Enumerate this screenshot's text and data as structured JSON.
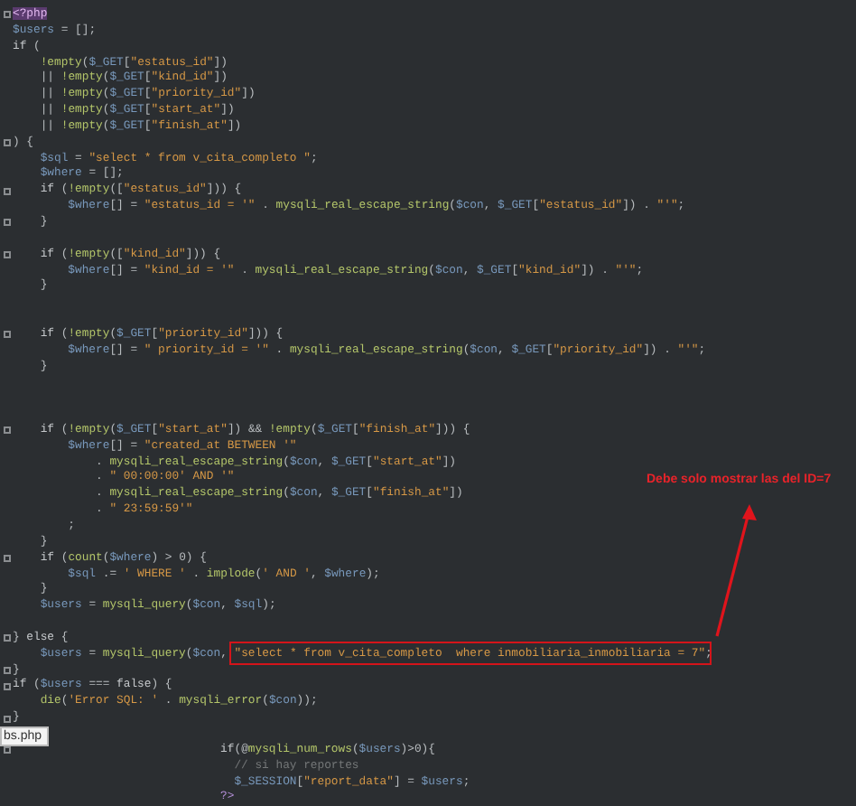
{
  "lines": [
    {
      "kind": "code",
      "fold": true,
      "tokens": [
        {
          "kind": "tag",
          "text": "<?php"
        }
      ]
    },
    {
      "kind": "code",
      "fold": false,
      "tokens": [
        {
          "kind": "var",
          "text": "$users"
        },
        {
          "kind": "op",
          "text": " = [];"
        }
      ]
    },
    {
      "kind": "code",
      "fold": false,
      "tokens": [
        {
          "kind": "kw",
          "text": "if"
        },
        {
          "kind": "op",
          "text": " ("
        }
      ]
    },
    {
      "kind": "code",
      "fold": false,
      "tokens": [
        {
          "kind": "fn",
          "text": "    !empty"
        },
        {
          "kind": "op",
          "text": "("
        },
        {
          "kind": "var",
          "text": "$_GET"
        },
        {
          "kind": "op",
          "text": "["
        },
        {
          "kind": "str",
          "text": "\"estatus_id\""
        },
        {
          "kind": "op",
          "text": "])"
        }
      ]
    },
    {
      "kind": "code",
      "fold": false,
      "tokens": [
        {
          "kind": "op",
          "text": "    || "
        },
        {
          "kind": "fn",
          "text": "!empty"
        },
        {
          "kind": "op",
          "text": "("
        },
        {
          "kind": "var",
          "text": "$_GET"
        },
        {
          "kind": "op",
          "text": "["
        },
        {
          "kind": "str",
          "text": "\"kind_id\""
        },
        {
          "kind": "op",
          "text": "])"
        }
      ]
    },
    {
      "kind": "code",
      "fold": false,
      "tokens": [
        {
          "kind": "op",
          "text": "    || "
        },
        {
          "kind": "fn",
          "text": "!empty"
        },
        {
          "kind": "op",
          "text": "("
        },
        {
          "kind": "var",
          "text": "$_GET"
        },
        {
          "kind": "op",
          "text": "["
        },
        {
          "kind": "str",
          "text": "\"priority_id\""
        },
        {
          "kind": "op",
          "text": "])"
        }
      ]
    },
    {
      "kind": "code",
      "fold": false,
      "tokens": [
        {
          "kind": "op",
          "text": "    || "
        },
        {
          "kind": "fn",
          "text": "!empty"
        },
        {
          "kind": "op",
          "text": "("
        },
        {
          "kind": "var",
          "text": "$_GET"
        },
        {
          "kind": "op",
          "text": "["
        },
        {
          "kind": "str",
          "text": "\"start_at\""
        },
        {
          "kind": "op",
          "text": "])"
        }
      ]
    },
    {
      "kind": "code",
      "fold": false,
      "tokens": [
        {
          "kind": "op",
          "text": "    || "
        },
        {
          "kind": "fn",
          "text": "!empty"
        },
        {
          "kind": "op",
          "text": "("
        },
        {
          "kind": "var",
          "text": "$_GET"
        },
        {
          "kind": "op",
          "text": "["
        },
        {
          "kind": "str",
          "text": "\"finish_at\""
        },
        {
          "kind": "op",
          "text": "])"
        }
      ]
    },
    {
      "kind": "code",
      "fold": true,
      "tokens": [
        {
          "kind": "op",
          "text": ") {"
        }
      ]
    },
    {
      "kind": "code",
      "fold": false,
      "tokens": [
        {
          "kind": "var",
          "text": "    $sql"
        },
        {
          "kind": "op",
          "text": " = "
        },
        {
          "kind": "str",
          "text": "\"select * from v_cita_completo \""
        },
        {
          "kind": "op",
          "text": ";"
        }
      ]
    },
    {
      "kind": "code",
      "fold": false,
      "tokens": [
        {
          "kind": "var",
          "text": "    $where"
        },
        {
          "kind": "op",
          "text": " = [];"
        }
      ]
    },
    {
      "kind": "code",
      "fold": true,
      "tokens": [
        {
          "kind": "kw",
          "text": "    if"
        },
        {
          "kind": "op",
          "text": " ("
        },
        {
          "kind": "fn",
          "text": "!empty"
        },
        {
          "kind": "op",
          "text": "(["
        },
        {
          "kind": "str",
          "text": "\"estatus_id\""
        },
        {
          "kind": "op",
          "text": "])) {"
        }
      ]
    },
    {
      "kind": "code",
      "fold": false,
      "tokens": [
        {
          "kind": "var",
          "text": "        $where"
        },
        {
          "kind": "op",
          "text": "[] = "
        },
        {
          "kind": "str",
          "text": "\"estatus_id = '\""
        },
        {
          "kind": "op",
          "text": " . "
        },
        {
          "kind": "fn",
          "text": "mysqli_real_escape_string"
        },
        {
          "kind": "op",
          "text": "("
        },
        {
          "kind": "var",
          "text": "$con"
        },
        {
          "kind": "op",
          "text": ", "
        },
        {
          "kind": "var",
          "text": "$_GET"
        },
        {
          "kind": "op",
          "text": "["
        },
        {
          "kind": "str",
          "text": "\"estatus_id\""
        },
        {
          "kind": "op",
          "text": "]) . "
        },
        {
          "kind": "str",
          "text": "\"'\""
        },
        {
          "kind": "op",
          "text": ";"
        }
      ]
    },
    {
      "kind": "code",
      "fold": true,
      "tokens": [
        {
          "kind": "op",
          "text": "    }"
        }
      ]
    },
    {
      "kind": "blank"
    },
    {
      "kind": "code",
      "fold": true,
      "tokens": [
        {
          "kind": "kw",
          "text": "    if"
        },
        {
          "kind": "op",
          "text": " ("
        },
        {
          "kind": "fn",
          "text": "!empty"
        },
        {
          "kind": "op",
          "text": "(["
        },
        {
          "kind": "str",
          "text": "\"kind_id\""
        },
        {
          "kind": "op",
          "text": "])) {"
        }
      ]
    },
    {
      "kind": "code",
      "fold": false,
      "tokens": [
        {
          "kind": "var",
          "text": "        $where"
        },
        {
          "kind": "op",
          "text": "[] = "
        },
        {
          "kind": "str",
          "text": "\"kind_id = '\""
        },
        {
          "kind": "op",
          "text": " . "
        },
        {
          "kind": "fn",
          "text": "mysqli_real_escape_string"
        },
        {
          "kind": "op",
          "text": "("
        },
        {
          "kind": "var",
          "text": "$con"
        },
        {
          "kind": "op",
          "text": ", "
        },
        {
          "kind": "var",
          "text": "$_GET"
        },
        {
          "kind": "op",
          "text": "["
        },
        {
          "kind": "str",
          "text": "\"kind_id\""
        },
        {
          "kind": "op",
          "text": "]) . "
        },
        {
          "kind": "str",
          "text": "\"'\""
        },
        {
          "kind": "op",
          "text": ";"
        }
      ]
    },
    {
      "kind": "code",
      "fold": false,
      "tokens": [
        {
          "kind": "op",
          "text": "    }"
        }
      ]
    },
    {
      "kind": "blank"
    },
    {
      "kind": "blank"
    },
    {
      "kind": "code",
      "fold": true,
      "tokens": [
        {
          "kind": "kw",
          "text": "    if"
        },
        {
          "kind": "op",
          "text": " ("
        },
        {
          "kind": "fn",
          "text": "!empty"
        },
        {
          "kind": "op",
          "text": "("
        },
        {
          "kind": "var",
          "text": "$_GET"
        },
        {
          "kind": "op",
          "text": "["
        },
        {
          "kind": "str",
          "text": "\"priority_id\""
        },
        {
          "kind": "op",
          "text": "])) {"
        }
      ]
    },
    {
      "kind": "code",
      "fold": false,
      "tokens": [
        {
          "kind": "var",
          "text": "        $where"
        },
        {
          "kind": "op",
          "text": "[] = "
        },
        {
          "kind": "str",
          "text": "\" priority_id = '\""
        },
        {
          "kind": "op",
          "text": " . "
        },
        {
          "kind": "fn",
          "text": "mysqli_real_escape_string"
        },
        {
          "kind": "op",
          "text": "("
        },
        {
          "kind": "var",
          "text": "$con"
        },
        {
          "kind": "op",
          "text": ", "
        },
        {
          "kind": "var",
          "text": "$_GET"
        },
        {
          "kind": "op",
          "text": "["
        },
        {
          "kind": "str",
          "text": "\"priority_id\""
        },
        {
          "kind": "op",
          "text": "]) . "
        },
        {
          "kind": "str",
          "text": "\"'\""
        },
        {
          "kind": "op",
          "text": ";"
        }
      ]
    },
    {
      "kind": "code",
      "fold": false,
      "tokens": [
        {
          "kind": "op",
          "text": "    }"
        }
      ]
    },
    {
      "kind": "blank"
    },
    {
      "kind": "blank"
    },
    {
      "kind": "blank"
    },
    {
      "kind": "code",
      "fold": true,
      "tokens": [
        {
          "kind": "kw",
          "text": "    if"
        },
        {
          "kind": "op",
          "text": " ("
        },
        {
          "kind": "fn",
          "text": "!empty"
        },
        {
          "kind": "op",
          "text": "("
        },
        {
          "kind": "var",
          "text": "$_GET"
        },
        {
          "kind": "op",
          "text": "["
        },
        {
          "kind": "str",
          "text": "\"start_at\""
        },
        {
          "kind": "op",
          "text": "]) && "
        },
        {
          "kind": "fn",
          "text": "!empty"
        },
        {
          "kind": "op",
          "text": "("
        },
        {
          "kind": "var",
          "text": "$_GET"
        },
        {
          "kind": "op",
          "text": "["
        },
        {
          "kind": "str",
          "text": "\"finish_at\""
        },
        {
          "kind": "op",
          "text": "])) {"
        }
      ]
    },
    {
      "kind": "code",
      "fold": false,
      "tokens": [
        {
          "kind": "var",
          "text": "        $where"
        },
        {
          "kind": "op",
          "text": "[] = "
        },
        {
          "kind": "str",
          "text": "\"created_at BETWEEN '\""
        }
      ]
    },
    {
      "kind": "code",
      "fold": false,
      "tokens": [
        {
          "kind": "op",
          "text": "            . "
        },
        {
          "kind": "fn",
          "text": "mysqli_real_escape_string"
        },
        {
          "kind": "op",
          "text": "("
        },
        {
          "kind": "var",
          "text": "$con"
        },
        {
          "kind": "op",
          "text": ", "
        },
        {
          "kind": "var",
          "text": "$_GET"
        },
        {
          "kind": "op",
          "text": "["
        },
        {
          "kind": "str",
          "text": "\"start_at\""
        },
        {
          "kind": "op",
          "text": "])"
        }
      ]
    },
    {
      "kind": "code",
      "fold": false,
      "tokens": [
        {
          "kind": "op",
          "text": "            . "
        },
        {
          "kind": "str",
          "text": "\" 00:00:00' AND '\""
        }
      ]
    },
    {
      "kind": "code",
      "fold": false,
      "tokens": [
        {
          "kind": "op",
          "text": "            . "
        },
        {
          "kind": "fn",
          "text": "mysqli_real_escape_string"
        },
        {
          "kind": "op",
          "text": "("
        },
        {
          "kind": "var",
          "text": "$con"
        },
        {
          "kind": "op",
          "text": ", "
        },
        {
          "kind": "var",
          "text": "$_GET"
        },
        {
          "kind": "op",
          "text": "["
        },
        {
          "kind": "str",
          "text": "\"finish_at\""
        },
        {
          "kind": "op",
          "text": "])"
        }
      ]
    },
    {
      "kind": "code",
      "fold": false,
      "tokens": [
        {
          "kind": "op",
          "text": "            . "
        },
        {
          "kind": "str",
          "text": "\" 23:59:59'\""
        }
      ]
    },
    {
      "kind": "code",
      "fold": false,
      "tokens": [
        {
          "kind": "op",
          "text": "        ;"
        }
      ]
    },
    {
      "kind": "code",
      "fold": false,
      "tokens": [
        {
          "kind": "op",
          "text": "    }"
        }
      ]
    },
    {
      "kind": "code",
      "fold": true,
      "tokens": [
        {
          "kind": "kw",
          "text": "    if"
        },
        {
          "kind": "op",
          "text": " ("
        },
        {
          "kind": "fn",
          "text": "count"
        },
        {
          "kind": "op",
          "text": "("
        },
        {
          "kind": "var",
          "text": "$where"
        },
        {
          "kind": "op",
          "text": ") > 0) {"
        }
      ]
    },
    {
      "kind": "code",
      "fold": false,
      "tokens": [
        {
          "kind": "var",
          "text": "        $sql"
        },
        {
          "kind": "op",
          "text": " .= "
        },
        {
          "kind": "str",
          "text": "' WHERE '"
        },
        {
          "kind": "op",
          "text": " . "
        },
        {
          "kind": "fn",
          "text": "implode"
        },
        {
          "kind": "op",
          "text": "("
        },
        {
          "kind": "str",
          "text": "' AND '"
        },
        {
          "kind": "op",
          "text": ", "
        },
        {
          "kind": "var",
          "text": "$where"
        },
        {
          "kind": "op",
          "text": ");"
        }
      ]
    },
    {
      "kind": "code",
      "fold": false,
      "tokens": [
        {
          "kind": "op",
          "text": "    }"
        }
      ]
    },
    {
      "kind": "code",
      "fold": false,
      "tokens": [
        {
          "kind": "var",
          "text": "    $users"
        },
        {
          "kind": "op",
          "text": " = "
        },
        {
          "kind": "fn",
          "text": "mysqli_query"
        },
        {
          "kind": "op",
          "text": "("
        },
        {
          "kind": "var",
          "text": "$con"
        },
        {
          "kind": "op",
          "text": ", "
        },
        {
          "kind": "var",
          "text": "$sql"
        },
        {
          "kind": "op",
          "text": ");"
        }
      ]
    },
    {
      "kind": "blank"
    },
    {
      "kind": "code",
      "fold": true,
      "tokens": [
        {
          "kind": "op",
          "text": "} "
        },
        {
          "kind": "kw",
          "text": "else"
        },
        {
          "kind": "op",
          "text": " {"
        }
      ]
    },
    {
      "kind": "code",
      "fold": false,
      "tokens": [
        {
          "kind": "var",
          "text": "    $users"
        },
        {
          "kind": "op",
          "text": " = "
        },
        {
          "kind": "fn",
          "text": "mysqli_query"
        },
        {
          "kind": "op",
          "text": "("
        },
        {
          "kind": "var",
          "text": "$con"
        },
        {
          "kind": "op",
          "text": ", "
        },
        {
          "kind": "str",
          "text": "\"select * from v_cita_completo  where inmobiliaria_inmobiliaria = 7\"",
          "boxed": true
        },
        {
          "kind": "op",
          "text": ";"
        }
      ]
    },
    {
      "kind": "code",
      "fold": true,
      "tokens": [
        {
          "kind": "op",
          "text": "}"
        }
      ]
    },
    {
      "kind": "code",
      "fold": true,
      "tokens": [
        {
          "kind": "kw",
          "text": "if"
        },
        {
          "kind": "op",
          "text": " ("
        },
        {
          "kind": "var",
          "text": "$users"
        },
        {
          "kind": "op",
          "text": " === "
        },
        {
          "kind": "kw",
          "text": "false"
        },
        {
          "kind": "op",
          "text": ") {"
        }
      ]
    },
    {
      "kind": "code",
      "fold": false,
      "tokens": [
        {
          "kind": "fn",
          "text": "    die"
        },
        {
          "kind": "op",
          "text": "("
        },
        {
          "kind": "str",
          "text": "'Error SQL: '"
        },
        {
          "kind": "op",
          "text": " . "
        },
        {
          "kind": "fn",
          "text": "mysqli_error"
        },
        {
          "kind": "op",
          "text": "("
        },
        {
          "kind": "var",
          "text": "$con"
        },
        {
          "kind": "op",
          "text": "));"
        }
      ]
    },
    {
      "kind": "code",
      "fold": true,
      "tokens": [
        {
          "kind": "op",
          "text": "}"
        }
      ]
    },
    {
      "kind": "blank"
    },
    {
      "kind": "code",
      "fold": true,
      "tokens": [
        {
          "kind": "kw",
          "text": "                              if"
        },
        {
          "kind": "op",
          "text": "(@"
        },
        {
          "kind": "fn",
          "text": "mysqli_num_rows"
        },
        {
          "kind": "op",
          "text": "("
        },
        {
          "kind": "var",
          "text": "$users"
        },
        {
          "kind": "op",
          "text": ")>0){"
        }
      ]
    },
    {
      "kind": "code",
      "fold": false,
      "tokens": [
        {
          "kind": "cmt",
          "text": "                                // si hay reportes"
        }
      ]
    },
    {
      "kind": "code",
      "fold": false,
      "tokens": [
        {
          "kind": "var",
          "text": "                                $_SESSION"
        },
        {
          "kind": "op",
          "text": "["
        },
        {
          "kind": "str",
          "text": "\"report_data\""
        },
        {
          "kind": "op",
          "text": "] = "
        },
        {
          "kind": "var",
          "text": "$users"
        },
        {
          "kind": "op",
          "text": ";"
        }
      ]
    },
    {
      "kind": "code",
      "fold": false,
      "tokens": [
        {
          "kind": "tag2",
          "text": "                              ?>"
        }
      ]
    }
  ],
  "annotation": {
    "text": "Debe solo mostrar las del ID=7"
  },
  "file_tooltip": "bs.php"
}
